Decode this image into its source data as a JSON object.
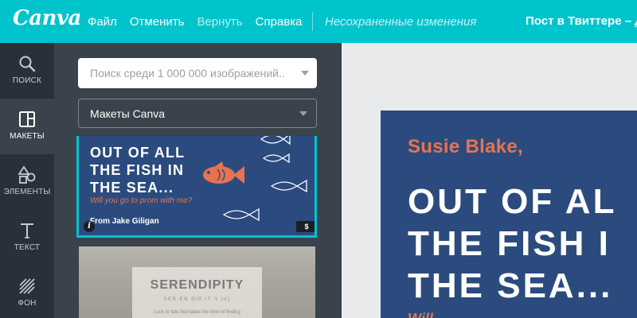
{
  "app": {
    "logo": "Canva"
  },
  "menu": {
    "file": "Файл",
    "undo": "Отменить",
    "redo": "Вернуть",
    "help": "Справка",
    "status": "Несохраненные изменения",
    "doc_title": "Пост в Твиттере – Д"
  },
  "rail": {
    "items": [
      {
        "label": "ПОИСК",
        "icon": "search-icon"
      },
      {
        "label": "МАКЕТЫ",
        "icon": "layouts-icon"
      },
      {
        "label": "ЭЛЕМЕНТЫ",
        "icon": "shapes-icon"
      },
      {
        "label": "ТЕКСТ",
        "icon": "text-icon"
      },
      {
        "label": "ФОН",
        "icon": "background-icon"
      }
    ]
  },
  "panel": {
    "search_placeholder": "Поиск среди 1 000 000 изображений...",
    "layouts_select": "Макеты Canva",
    "template1": {
      "headline": "OUT OF ALL\nTHE FISH IN\nTHE SEA...",
      "subline": "Will you go to prom with me?",
      "from": "From Jake Giligan",
      "info_badge": "i",
      "price_badge": "$"
    },
    "template2": {
      "title": "SERENDIPITY",
      "phonetic": "SER·EN·DIP·IT·Y (n)",
      "definition": "Luck or fate that takes the form of finding"
    }
  },
  "design": {
    "name": "Susie Blake,",
    "headline": "OUT OF AL\nTHE FISH I\nTHE SEA...",
    "tail": "Will"
  },
  "colors": {
    "topbar": "#00c4cc",
    "rail": "#293039",
    "panel": "#3a424b",
    "design_bg": "#2b4b7e",
    "accent_orange": "#e8734e"
  }
}
